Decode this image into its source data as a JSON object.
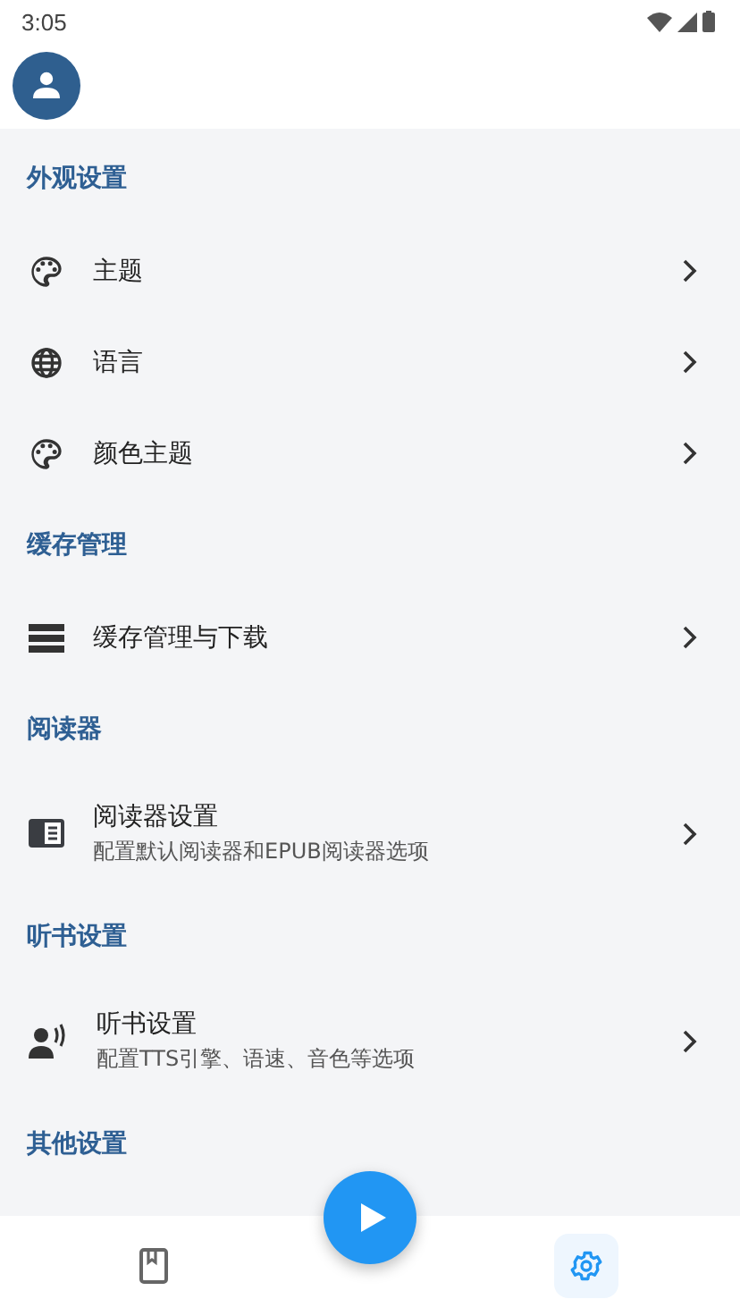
{
  "status_bar": {
    "time": "3:05"
  },
  "sections": [
    {
      "title": "外观设置",
      "items": [
        {
          "title": "主题"
        },
        {
          "title": "语言"
        },
        {
          "title": "颜色主题"
        }
      ]
    },
    {
      "title": "缓存管理",
      "items": [
        {
          "title": "缓存管理与下载"
        }
      ]
    },
    {
      "title": "阅读器",
      "items": [
        {
          "title": "阅读器设置",
          "subtitle": "配置默认阅读器和EPUB阅读器选项"
        }
      ]
    },
    {
      "title": "听书设置",
      "items": [
        {
          "title": "听书设置",
          "subtitle": "配置TTS引擎、语速、音色等选项"
        }
      ]
    },
    {
      "title": "其他设置"
    }
  ],
  "bottom_nav": [
    {
      "selected": false
    },
    {
      "selected": true
    }
  ]
}
